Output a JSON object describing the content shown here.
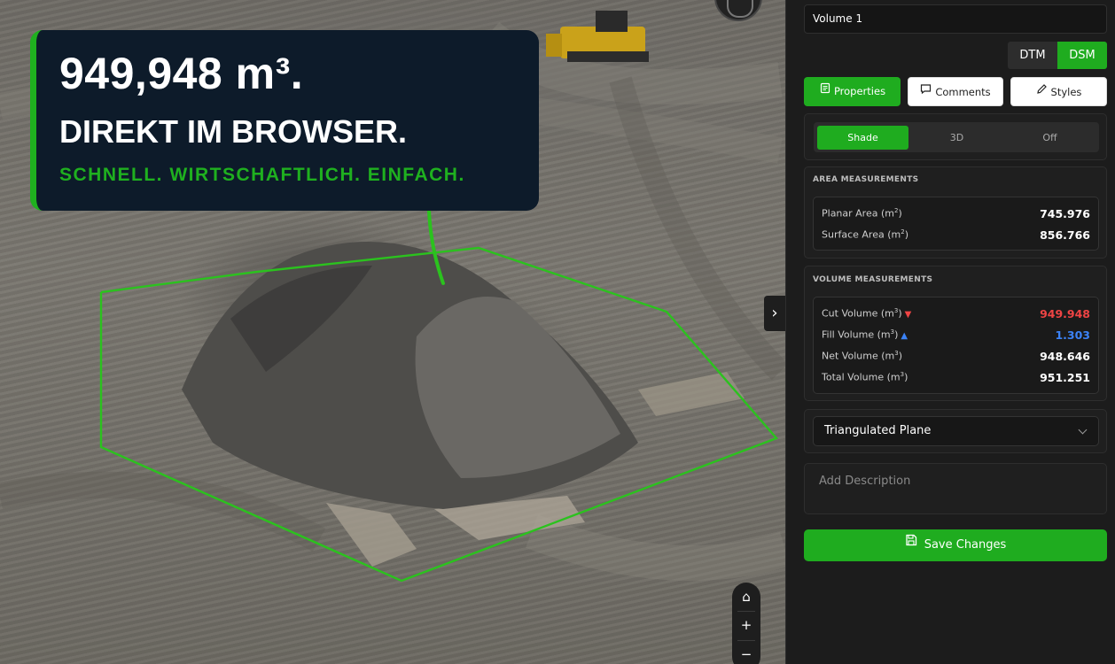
{
  "banner": {
    "headline": "949,948 m³.",
    "subheadline": "DIREKT IM BROWSER.",
    "tagline": "SCHNELL. WIRTSCHAFTLICH. EINFACH."
  },
  "colors": {
    "accent": "#1fac1f",
    "cut": "#ef4444",
    "fill": "#3b82f6",
    "banner_bg": "#0d1b2a"
  },
  "panel": {
    "volume_name": "Volume 1",
    "surface_toggle": [
      "DTM",
      "DSM"
    ],
    "surface_selected": "DSM",
    "tabs": {
      "properties": "Properties",
      "comments": "Comments",
      "styles": "Styles"
    },
    "shade_options": [
      "Shade",
      "3D",
      "Off"
    ],
    "shade_selected": "Shade",
    "area": {
      "title": "AREA MEASUREMENTS",
      "rows": [
        {
          "label": "Planar Area (m",
          "sup": "2",
          "suffix": ")",
          "value": "745.976"
        },
        {
          "label": "Surface Area (m",
          "sup": "2",
          "suffix": ")",
          "value": "856.766"
        }
      ]
    },
    "volume": {
      "title": "VOLUME MEASUREMENTS",
      "rows": [
        {
          "label": "Cut Volume (m",
          "sup": "3",
          "suffix": ")",
          "value": "949.948",
          "indicator": "▼"
        },
        {
          "label": "Fill Volume (m",
          "sup": "3",
          "suffix": ")",
          "value": "1.303",
          "indicator": "▲"
        },
        {
          "label": "Net Volume (m",
          "sup": "3",
          "suffix": ")",
          "value": "948.646"
        },
        {
          "label": "Total Volume (m",
          "sup": "3",
          "suffix": ")",
          "value": "951.251"
        }
      ]
    },
    "base_plane": "Triangulated Plane",
    "description_placeholder": "Add Description",
    "save_label": "Save Changes"
  },
  "map_controls": {
    "expand": "›",
    "home": "⌂",
    "zoom_in": "+",
    "zoom_out": "−"
  },
  "icons": [
    "home-icon",
    "zoom-in-icon",
    "zoom-out-icon",
    "chevron-right-icon",
    "chevron-down-icon",
    "properties-icon",
    "comments-icon",
    "pencil-icon",
    "save-icon",
    "compass-icon"
  ]
}
